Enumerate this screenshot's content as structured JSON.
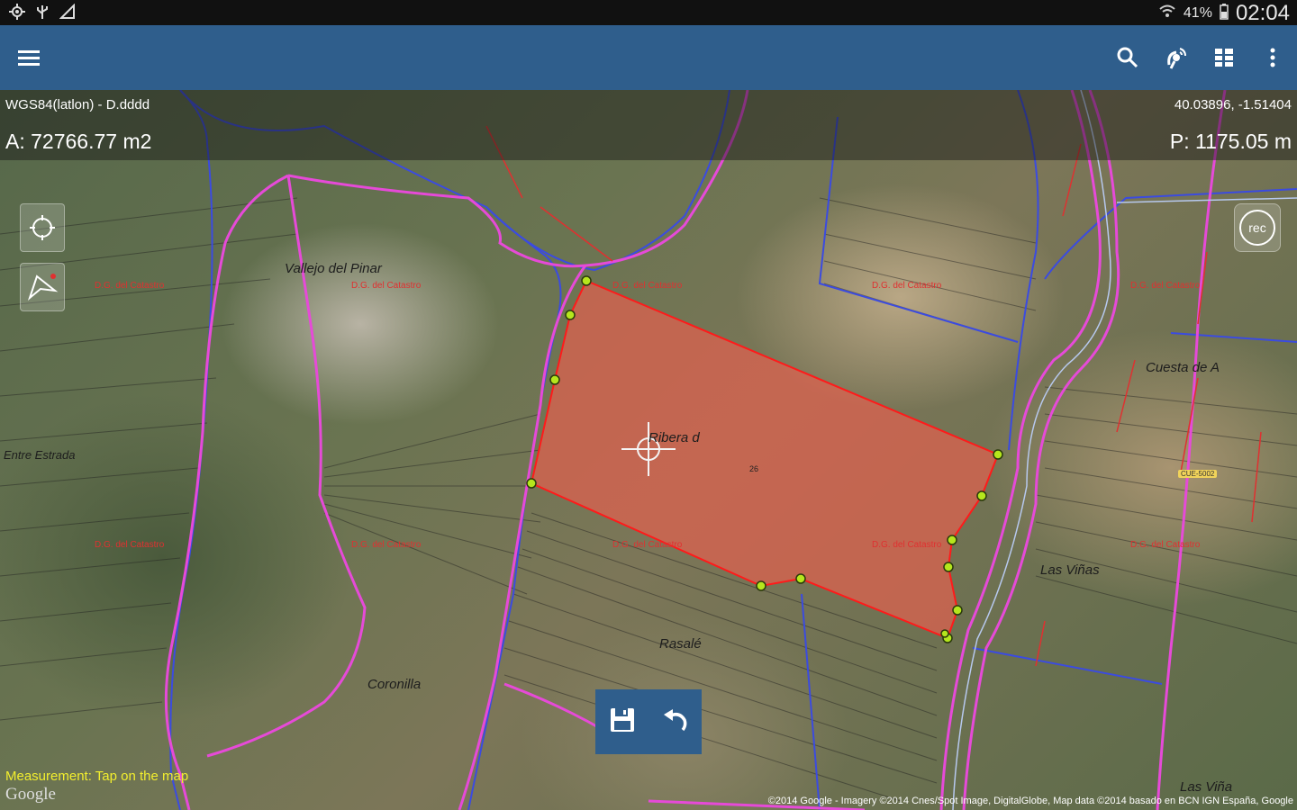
{
  "status_bar": {
    "battery": "41%",
    "time": "02:04",
    "left_icons": [
      "location-icon",
      "usb-icon",
      "signal-search-icon"
    ]
  },
  "app_bar": {
    "icons": [
      "menu-icon",
      "search-icon",
      "gps-antenna-icon",
      "layers-grid-icon",
      "overflow-menu-icon"
    ]
  },
  "info": {
    "crs": "WGS84(latlon) - D.dddd",
    "coords": "40.03896, -1.51404",
    "area": "A: 72766.77 m2",
    "perimeter": "P: 1175.05 m"
  },
  "map_controls": {
    "locate_icon": "crosshair-target-icon",
    "compass_icon": "compass-arrow-icon",
    "rec_label": "rec"
  },
  "map_labels": {
    "place_1": "Vallejo del Pinar",
    "place_2": "Ribera d",
    "place_3": "Cuesta de A",
    "place_4": "Las Viñas",
    "place_5": "Rasalé",
    "place_6": "Coronilla",
    "place_7": "Las Viña",
    "place_8": "Entre Estrada",
    "cadastre": "D.G. del Catastro",
    "parcel_26": "26",
    "road_sign": "CUE-5002"
  },
  "bottom_toolbar": {
    "save_icon": "save-floppy-icon",
    "undo_icon": "undo-arrow-icon"
  },
  "footer": {
    "hint": "Measurement: Tap on the map",
    "logo": "Google",
    "attribution": "©2014 Google - Imagery ©2014 Cnes/Spot Image, DigitalGlobe, Map data ©2014 basado en BCN IGN España, Google"
  },
  "colors": {
    "app_bar": "#2f5e8c",
    "polygon_fill": "#e0614f",
    "polygon_stroke": "#ff1a1a",
    "vertex": "#b5e61d",
    "boundary_pink": "#e64ad8",
    "boundary_blue": "#3b4be0",
    "hint_text": "#f2ee2e"
  }
}
